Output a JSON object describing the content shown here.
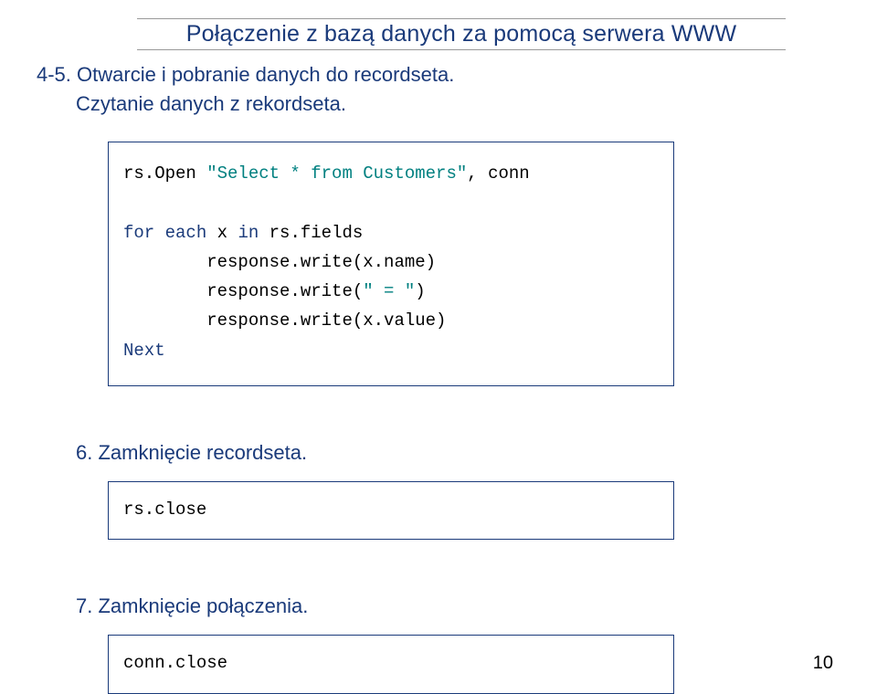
{
  "title": "Połączenie z bazą danych za pomocą serwera WWW",
  "section45_line1": "4-5. Otwarcie i pobranie danych do recordseta.",
  "section45_line2": "Czytanie danych z rekordseta.",
  "code1": {
    "l1a": "rs.Open ",
    "l1b": "\"Select * from Customers\"",
    "l1c": ", conn",
    "l2a": "for each",
    "l2b": " x ",
    "l2c": "in",
    "l2d": " rs.fields",
    "l3": "        response.write(x.name)",
    "l4a": "        response.write(",
    "l4b": "\" = \"",
    "l4c": ")",
    "l5": "        response.write(x.value)",
    "l6": "Next"
  },
  "section6": "6. Zamknięcie recordseta.",
  "code2": "rs.close",
  "section7": "7. Zamknięcie połączenia.",
  "code3": "conn.close",
  "pagenum": "10"
}
